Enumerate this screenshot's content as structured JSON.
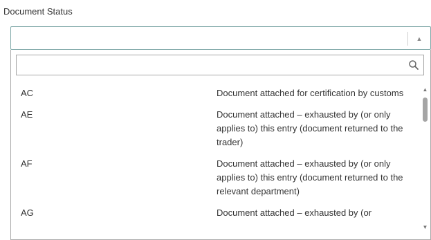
{
  "field": {
    "label": "Document Status",
    "selected_value": ""
  },
  "search": {
    "value": "",
    "placeholder": ""
  },
  "icons": {
    "dropdown_arrow": "triangle-up-icon",
    "search": "search-icon",
    "scroll_up": "scroll-up-arrow-icon",
    "scroll_down": "scroll-down-arrow-icon"
  },
  "options": [
    {
      "code": "AC",
      "description": "Document attached for certification by customs"
    },
    {
      "code": "AE",
      "description": "Document attached – exhausted by (or only applies to) this entry (document returned to the trader)"
    },
    {
      "code": "AF",
      "description": "Document attached – exhausted by (or only applies to) this entry (document returned to the relevant department)"
    },
    {
      "code": "AG",
      "description": "Document attached – exhausted by (or"
    }
  ],
  "colors": {
    "select_border": "#7fa8a8",
    "dropdown_border": "#a9a9a9",
    "scroll_thumb": "#a5a5a5"
  }
}
